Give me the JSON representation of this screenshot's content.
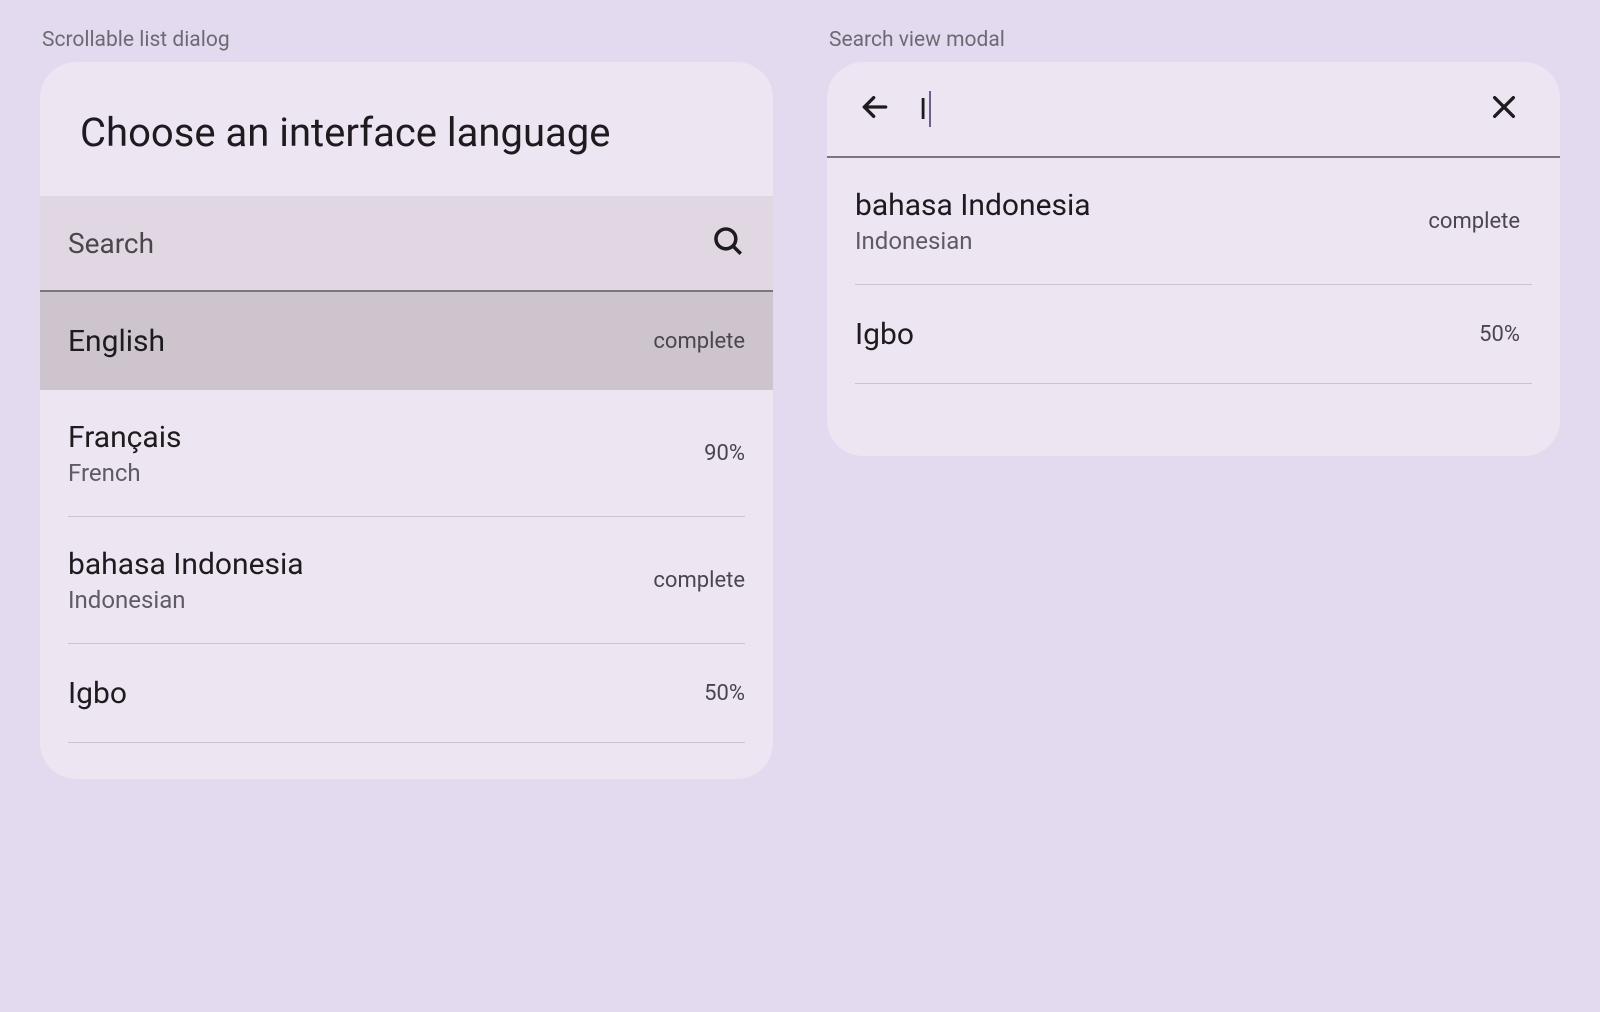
{
  "left": {
    "label": "Scrollable list dialog",
    "title": "Choose an interface language",
    "search_placeholder": "Search",
    "items": [
      {
        "primary": "English",
        "secondary": "",
        "status": "complete",
        "selected": true
      },
      {
        "primary": "Français",
        "secondary": "French",
        "status": "90%",
        "selected": false
      },
      {
        "primary": "bahasa Indonesia",
        "secondary": "Indonesian",
        "status": "complete",
        "selected": false
      },
      {
        "primary": "Igbo",
        "secondary": "",
        "status": "50%",
        "selected": false
      }
    ]
  },
  "right": {
    "label": "Search view modal",
    "query": "I",
    "items": [
      {
        "primary": "bahasa Indonesia",
        "secondary": "Indonesian",
        "status": "complete"
      },
      {
        "primary": "Igbo",
        "secondary": "",
        "status": "50%"
      }
    ]
  }
}
